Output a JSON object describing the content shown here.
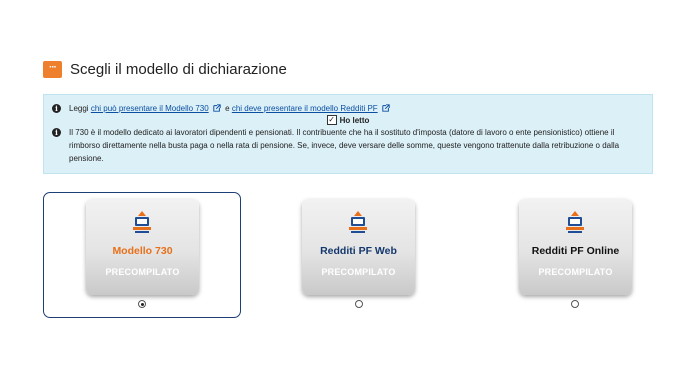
{
  "header": {
    "title": "Scegli il modello di dichiarazione",
    "icon": "more-dots-icon",
    "accent_color": "#ee7f2d"
  },
  "info": {
    "line1_prefix": "Leggi",
    "link1": "chi può presentare il Modello 730",
    "conjunction": "e",
    "link2": "chi deve presentare il modello Redditi PF",
    "checkbox_label": "Ho letto",
    "checkbox_checked": true,
    "paragraph": "Il 730 è il modello dedicato ai lavoratori dipendenti e pensionati. Il contribuente che ha il sostituto d'imposta (datore di lavoro o ente pensionistico) ottiene il rimborso direttamente nella busta paga o nella rata di pensione. Se, invece, deve versare delle somme, queste vengono trattenute dalla retribuzione o dalla pensione."
  },
  "cards": [
    {
      "title": "Modello 730",
      "subtitle": "PRECOMPILATO",
      "title_color": "#e8701a",
      "selected": true
    },
    {
      "title": "Redditi PF Web",
      "subtitle": "PRECOMPILATO",
      "title_color": "#14386d",
      "selected": false
    },
    {
      "title": "Redditi PF Online",
      "subtitle": "PRECOMPILATO",
      "title_color": "#111111",
      "selected": false
    }
  ]
}
